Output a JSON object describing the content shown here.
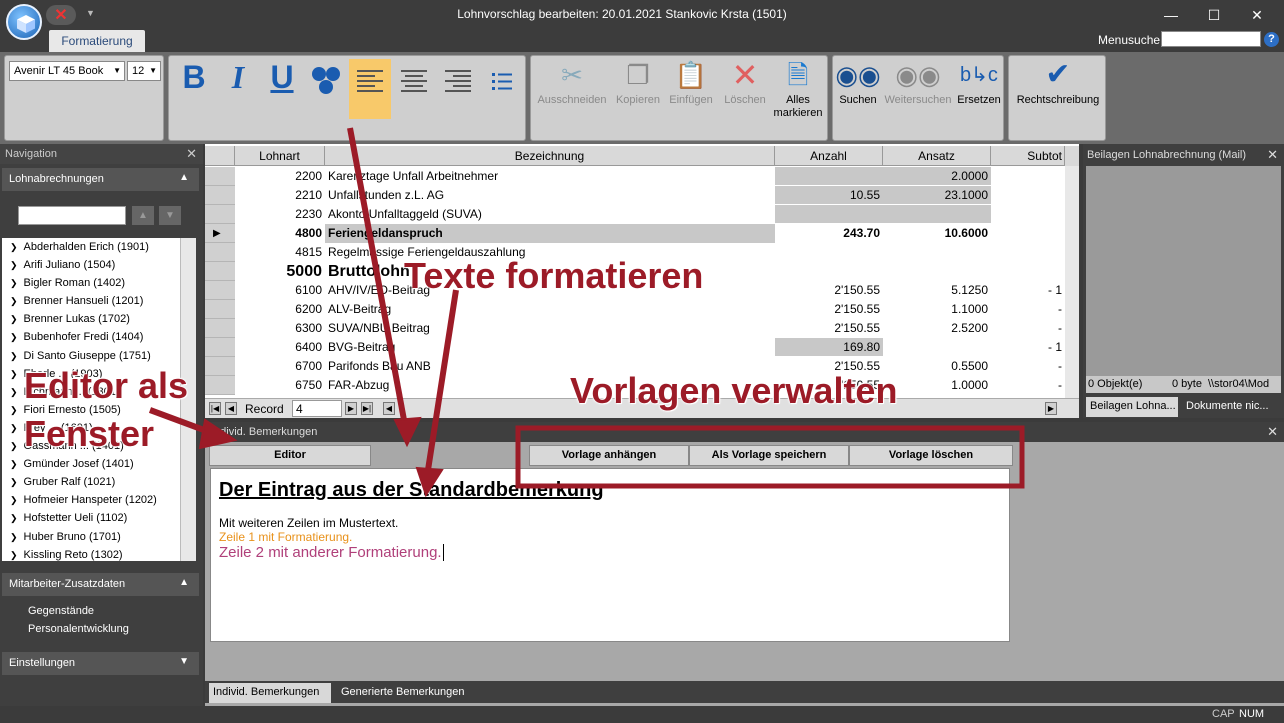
{
  "window": {
    "title": "Lohnvorschlag bearbeiten: 20.01.2021 Stankovic Krsta (1501)"
  },
  "ribbon": {
    "tab": "Formatierung",
    "menusuche_label": "Menusuche",
    "font_name": "Avenir LT 45 Book",
    "font_size": "12",
    "bold": "B",
    "italic": "I",
    "underline": "U",
    "buttons": {
      "cut": "Ausschneiden",
      "copy": "Kopieren",
      "paste": "Einfügen",
      "delete": "Löschen",
      "select_all_1": "Alles",
      "select_all_2": "markieren",
      "search": "Suchen",
      "search_next": "Weitersuchen",
      "replace": "Ersetzen",
      "spellcheck": "Rechtschreibung"
    }
  },
  "nav": {
    "header": "Navigation",
    "section1": "Lohnabrechnungen",
    "employees": [
      "Abderhalden Erich (1901)",
      "Arifi Juliano (1504)",
      "Bigler Roman (1402)",
      "Brenner Hansueli (1201)",
      "Brenner Lukas (1702)",
      "Bubenhofer Fredi (1404)",
      "Di Santo Giuseppe (1751)",
      "Eberle ... (1903)",
      "Eichmann ... (1301)",
      "Fiori Ernesto (1505)",
      "Frey ... (1601)",
      "Gassmann ... (1401)",
      "Gmünder Josef (1401)",
      "Gruber Ralf (1021)",
      "Hofmeier Hanspeter (1202)",
      "Hofstetter Ueli (1102)",
      "Huber Bruno (1701)",
      "Kissling Reto (1302)"
    ],
    "section2": "Mitarbeiter-Zusatzdaten",
    "zusatz_items": [
      "Gegenstände",
      "Personalentwicklung"
    ],
    "section3": "Einstellungen"
  },
  "grid": {
    "headers": [
      "Lohnart",
      "Bezeichnung",
      "Anzahl",
      "Ansatz",
      "Subtot"
    ],
    "rows": [
      {
        "code": "2200",
        "name": "Karenztage Unfall Arbeitnehmer",
        "anzahl": "",
        "ansatz": "2.0000",
        "subtot": ""
      },
      {
        "code": "2210",
        "name": "Unfallstunden z.L. AG",
        "anzahl": "10.55",
        "ansatz": "23.1000",
        "subtot": ""
      },
      {
        "code": "2230",
        "name": "Akonto Unfalltaggeld (SUVA)",
        "anzahl": "",
        "ansatz": "",
        "subtot": ""
      },
      {
        "code": "4800",
        "name": "Feriengeldanspruch",
        "anzahl": "243.70",
        "ansatz": "10.6000",
        "subtot": ""
      },
      {
        "code": "4815",
        "name": "Regelmässige Feriengeldauszahlung",
        "anzahl": "",
        "ansatz": "",
        "subtot": ""
      },
      {
        "code": "5000",
        "name": "Bruttolohn",
        "anzahl": "",
        "ansatz": "",
        "subtot": ""
      },
      {
        "code": "6100",
        "name": "AHV/IV/EO-Beitrag",
        "anzahl": "2'150.55",
        "ansatz": "5.1250",
        "subtot": "- 1"
      },
      {
        "code": "6200",
        "name": "ALV-Beitrag",
        "anzahl": "2'150.55",
        "ansatz": "1.1000",
        "subtot": "-"
      },
      {
        "code": "6300",
        "name": "SUVA/NBU Beitrag",
        "anzahl": "2'150.55",
        "ansatz": "2.5200",
        "subtot": "-"
      },
      {
        "code": "6400",
        "name": "BVG-Beitrag",
        "anzahl": "169.80",
        "ansatz": "",
        "subtot": "- 1"
      },
      {
        "code": "6700",
        "name": "Parifonds Bau ANB",
        "anzahl": "2'150.55",
        "ansatz": "0.5500",
        "subtot": "-"
      },
      {
        "code": "6750",
        "name": "FAR-Abzug",
        "anzahl": "2'150.55",
        "ansatz": "1.0000",
        "subtot": "-"
      }
    ],
    "record_label": "Record",
    "record_value": "4"
  },
  "beilagen": {
    "header": "Beilagen Lohnabrechnung (Mail)",
    "status": [
      "0 Objekt(e)",
      "0 byte",
      "\\\\stor04\\Mod"
    ],
    "tabs": [
      "Beilagen Lohna...",
      "Dokumente nic..."
    ]
  },
  "bemerkungen": {
    "header": "Individ. Bemerkungen",
    "editor_btn": "Editor",
    "vorlage_anhaengen": "Vorlage anhängen",
    "als_vorlage": "Als Vorlage speichern",
    "vorlage_loeschen": "Vorlage löschen",
    "line1": "Der Eintrag aus der Standardbemerkung",
    "line2": "Mit weiteren Zeilen im Mustertext.",
    "line3": "Zeile 1 mit Formatierung.",
    "line4": "Zeile 2 mit anderer Formatierung.",
    "tabs": [
      "Individ. Bemerkungen",
      "Generierte Bemerkungen"
    ]
  },
  "status": {
    "cap": "CAP",
    "num": "NUM"
  },
  "annotations": {
    "texte": "Texte formatieren",
    "editor1": "Editor als",
    "editor2": "Fenster",
    "vorlagen": "Vorlagen verwalten"
  },
  "colors": {
    "annotation": "#9c1b27",
    "accent": "#1a5cb0",
    "orange": "#e8911a",
    "magenta": "#b0407a"
  }
}
